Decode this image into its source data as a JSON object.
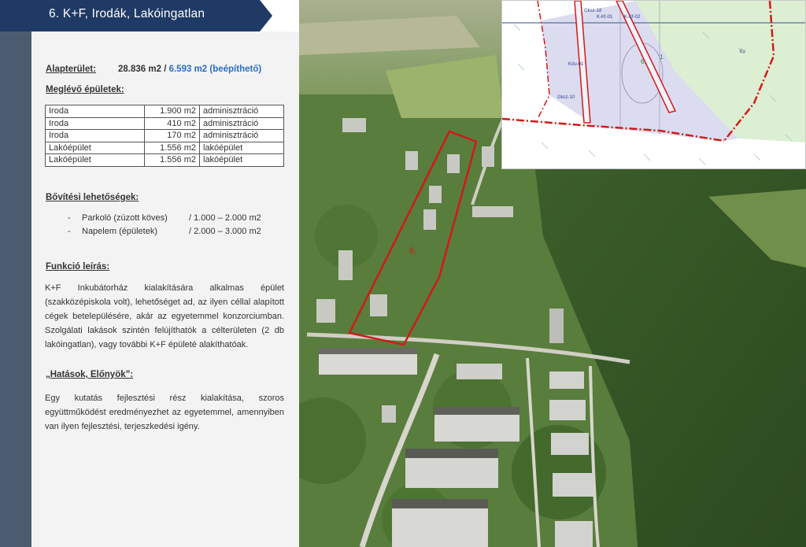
{
  "title": "6.  K+F, Irodák, Lakóingatlan",
  "area": {
    "label": "Alapterület:",
    "total": "28.836 m2",
    "separator": " / ",
    "buildable": "6.593 m2 (beépíthető)"
  },
  "existing": {
    "heading": "Meglévő épületek:",
    "rows": [
      {
        "name": "Iroda",
        "size": "1.900 m2",
        "use": "adminisztráció"
      },
      {
        "name": "Iroda",
        "size": "410 m2",
        "use": "adminisztráció"
      },
      {
        "name": "Iroda",
        "size": "170 m2",
        "use": "adminisztráció"
      },
      {
        "name": "Lakóépület",
        "size": "1.556 m2",
        "use": "lakóépület"
      },
      {
        "name": "Lakóépület",
        "size": "1.556 m2",
        "use": "lakóépület"
      }
    ]
  },
  "expansion": {
    "heading": "Bővítési lehetőségek:",
    "items": [
      {
        "dash": "-",
        "name": "Parkoló (zúzott köves)",
        "range": "/ 1.000 – 2.000 m2"
      },
      {
        "dash": "-",
        "name": "Napelem (épületek)",
        "range": "/ 2.000 – 3.000 m2"
      }
    ]
  },
  "function": {
    "heading": "Funkció leírás:",
    "text": "K+F Inkubátorház kialakítására alkalmas épület (szakközépiskola volt), lehetőséget ad, az ilyen céllal alapított cégek betelepülésére, akár az egyetemmel konzorciumban. Szolgálati lakások szintén felújíthatók a célterületen (2 db lakóingatlan), vagy további K+F épületé alakíthatóak."
  },
  "effects": {
    "heading": "„Hatások, Előnyök”:",
    "text": "Egy kutatás fejlesztési rész kialakítása, szoros együttműködést eredményezhet az egyetemmel, amennyiben van ilyen fejlesztési, terjeszkedési igény."
  },
  "map": {
    "plot_label": "6.",
    "inset_labels": [
      "Gksz-18",
      "K-Kf-01",
      "K-Kf-02",
      "Köu-01",
      "Gksz-10",
      "Ev",
      "1.",
      "6."
    ]
  },
  "colors": {
    "banner": "#1f3a64",
    "side_strip": "#45556a",
    "accent_blue": "#2a6ec2",
    "boundary_red": "#d11a1a"
  }
}
